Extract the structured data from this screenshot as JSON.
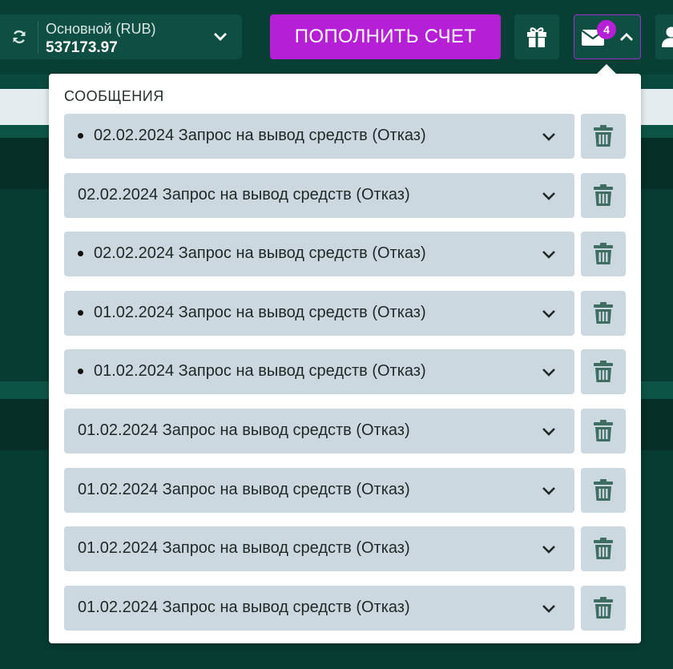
{
  "header": {
    "account_name": "Основной  (RUB)",
    "balance": "537173.97",
    "deposit_label": "ПОПОЛНИТЬ СЧЕТ",
    "unread_count": "4"
  },
  "colors": {
    "accent": "#b51fd6",
    "background": "#063a30",
    "row": "#ccd8e0",
    "trash": "#3f6d62"
  },
  "messages_panel": {
    "title": "СООБЩЕНИЯ",
    "items": [
      {
        "text": "02.02.2024 Запрос на вывод средств (Отказ)",
        "unread": true
      },
      {
        "text": "02.02.2024 Запрос на вывод средств (Отказ)",
        "unread": false
      },
      {
        "text": "02.02.2024 Запрос на вывод средств (Отказ)",
        "unread": true
      },
      {
        "text": "01.02.2024 Запрос на вывод средств (Отказ)",
        "unread": true
      },
      {
        "text": "01.02.2024 Запрос на вывод средств (Отказ)",
        "unread": true
      },
      {
        "text": "01.02.2024 Запрос на вывод средств (Отказ)",
        "unread": false
      },
      {
        "text": "01.02.2024 Запрос на вывод средств (Отказ)",
        "unread": false
      },
      {
        "text": "01.02.2024 Запрос на вывод средств (Отказ)",
        "unread": false
      },
      {
        "text": "01.02.2024 Запрос на вывод средств (Отказ)",
        "unread": false
      }
    ]
  },
  "icons": [
    "refresh-icon",
    "chevron-down-icon",
    "gift-icon",
    "envelope-icon",
    "chevron-up-icon",
    "user-icon",
    "trash-icon"
  ]
}
